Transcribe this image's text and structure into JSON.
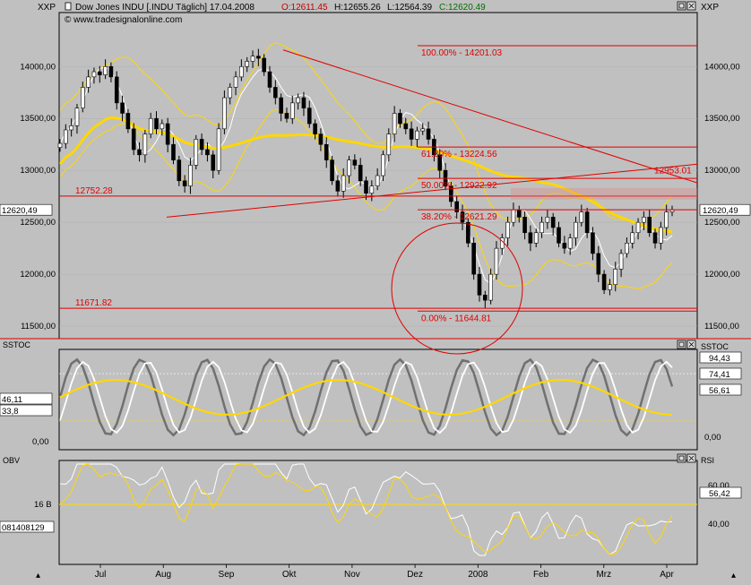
{
  "header": {
    "left_axis_label": "XXP",
    "right_axis_label": "XXP",
    "title": "Dow Jones INDU [.INDU  Täglich] 17.04.2008",
    "open": "O:12611.45",
    "high": "H:12655.26",
    "low": "L:12564.39",
    "close": "C:12620.49",
    "website": "www.tradesignalonline.com",
    "scroll_up_glyph": "▴"
  },
  "colors": {
    "background": "#c0c0c0",
    "candle_up": "#ffffff",
    "candle_down": "#000000",
    "bollinger": "#ffd700",
    "moving_average": "#ffd700",
    "fib_lines": "#e00000",
    "trendline": "#e00000",
    "white_line": "#ffffff",
    "stoch_fast": "#707070",
    "stoch_slow": "#ffffff",
    "stoch_signal": "#ffd700",
    "obv_line": "#ffffff",
    "rsi_line": "#ffd700",
    "ohlc_open": "#c00000",
    "ohlc_close": "#008000"
  },
  "chart_data": [
    {
      "type": "line",
      "panel": "price",
      "description_visible": "Candlestick price panel",
      "x_ticks": [
        "Jul",
        "Aug",
        "Sep",
        "Okt",
        "Nov",
        "Dez",
        "2008",
        "Feb",
        "Mrz",
        "Apr"
      ],
      "ylim": [
        11380,
        14520
      ],
      "y_ticks": [
        "14000,00",
        "13500,00",
        "13000,00",
        "12500,00",
        "12000,00",
        "11500,00"
      ],
      "y_tick_values": [
        14000,
        13500,
        13000,
        12500,
        12000,
        11500
      ],
      "last_value_label": "12620,49",
      "last_value": 12620.49,
      "fib_levels": [
        {
          "label": "100.00% - 14201.03",
          "value": 14201.03
        },
        {
          "label": "61.80% - 13224.56",
          "value": 13224.56
        },
        {
          "label": "50.00% - 12922.92",
          "value": 12922.92
        },
        {
          "label": "38.20% - 12621.29",
          "value": 12621.29
        },
        {
          "label": "0.00% - 11644.81",
          "value": 11644.81
        }
      ],
      "horizontal_levels": [
        {
          "label": "12752.28",
          "value": 12752.28
        },
        {
          "label": "11671.82",
          "value": 11671.82
        }
      ],
      "trendline_label": "12953.01",
      "candles_summary_close": [
        13260,
        13390,
        13430,
        13600,
        13800,
        13900,
        13950,
        13920,
        14000,
        13900,
        13650,
        13550,
        13400,
        13200,
        13150,
        13350,
        13500,
        13400,
        13450,
        13250,
        13100,
        12900,
        12850,
        13050,
        13300,
        13200,
        13150,
        13000,
        13400,
        13700,
        13800,
        13900,
        14000,
        14050,
        14100,
        14080,
        13950,
        13800,
        13700,
        13550,
        13500,
        13650,
        13700,
        13600,
        13450,
        13350,
        13250,
        13100,
        12900,
        12800,
        12950,
        13100,
        13050,
        12900,
        12780,
        12850,
        12950,
        13150,
        13350,
        13550,
        13450,
        13400,
        13300,
        13380,
        13400,
        13300,
        13150,
        13000,
        12850,
        12700,
        12600,
        12500,
        12300,
        12000,
        11800,
        11750,
        12000,
        12250,
        12350,
        12500,
        12620,
        12550,
        12400,
        12300,
        12400,
        12500,
        12550,
        12450,
        12300,
        12250,
        12350,
        12500,
        12600,
        12400,
        12200,
        12000,
        11850,
        11900,
        12050,
        12200,
        12300,
        12400,
        12500,
        12550,
        12400,
        12300,
        12450,
        12600,
        12620
      ]
    },
    {
      "type": "line",
      "panel": "sstoc",
      "label": "SSTOC",
      "ylim": [
        -5,
        105
      ],
      "y_ticks": [
        "0,00"
      ],
      "right_ticks": [
        "0,00"
      ],
      "value_labels_right": [
        "94,43",
        "74,41",
        "56,61"
      ],
      "value_labels_left": [
        "46,11",
        "33,8",
        "0,00"
      ]
    },
    {
      "type": "line",
      "panel": "obv_rsi",
      "left_label": "OBV",
      "right_label": "RSI",
      "left_ticks": [
        "16 B"
      ],
      "left_value_label": "081408129",
      "right_ticks": [
        "60,00",
        "40,00"
      ],
      "right_value_label": "56,42"
    }
  ]
}
